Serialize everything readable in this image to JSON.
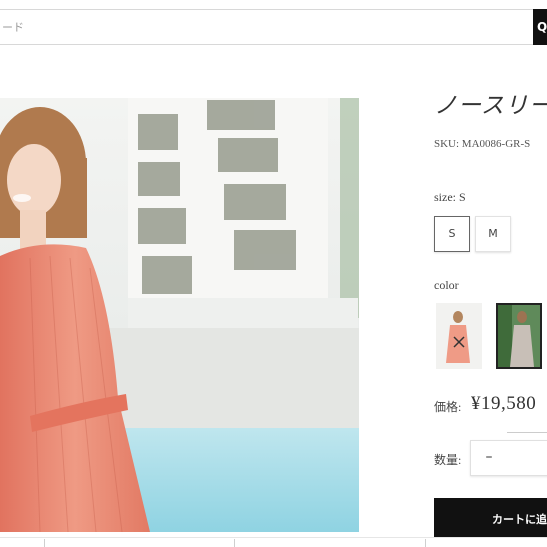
{
  "search": {
    "placeholder": "ード",
    "button_label": "Q"
  },
  "product": {
    "title": "ノースリー",
    "sku": "SKU: MA0086-GR-S",
    "size": {
      "label": "size: S",
      "options": [
        "S",
        "M"
      ],
      "selected": "S"
    },
    "color": {
      "label": "color",
      "swatches": [
        {
          "name": "pink",
          "available": false
        },
        {
          "name": "green",
          "selected": true
        }
      ]
    },
    "price": {
      "label": "価格:",
      "value": "¥19,580"
    },
    "quantity": {
      "label": "数量:",
      "minus_label": "–"
    },
    "cart_button": "カートに追"
  },
  "colors": {
    "dress": "#e8836f",
    "button_bg": "#111111"
  }
}
